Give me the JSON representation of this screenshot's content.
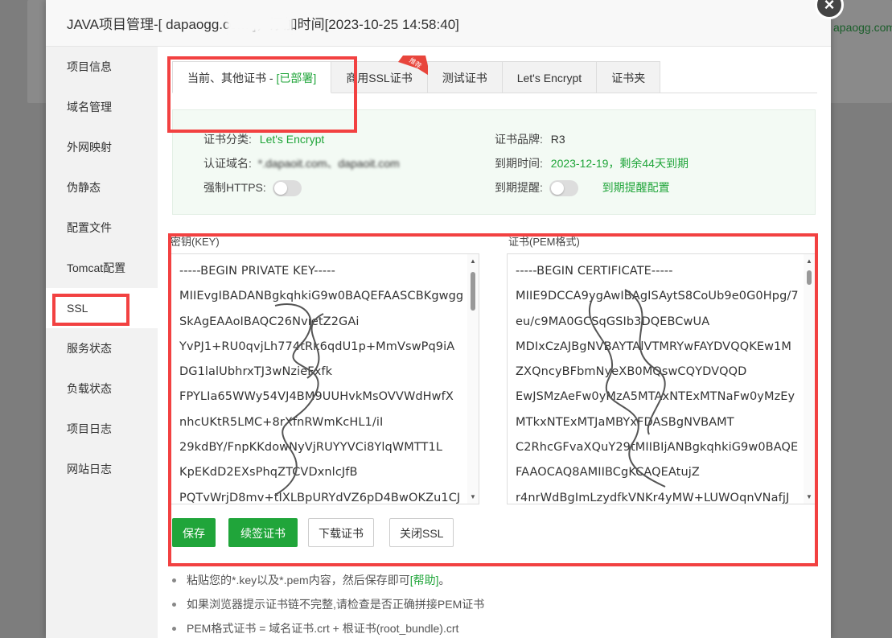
{
  "background": {
    "link_text": "apaogg.com"
  },
  "modal": {
    "title": "JAVA项目管理-[ dapaogg.com ]，添加时间[2023-10-25 14:58:40]",
    "close_glyph": "×"
  },
  "sidebar": {
    "items": [
      {
        "label": "项目信息"
      },
      {
        "label": "域名管理"
      },
      {
        "label": "外网映射"
      },
      {
        "label": "伪静态"
      },
      {
        "label": "配置文件"
      },
      {
        "label": "Tomcat配置"
      },
      {
        "label": "SSL"
      },
      {
        "label": "服务状态"
      },
      {
        "label": "负载状态"
      },
      {
        "label": "项目日志"
      },
      {
        "label": "网站日志"
      }
    ],
    "active_index": 6
  },
  "tabs": [
    {
      "label": "当前、其他证书 - ",
      "status": "[已部署]"
    },
    {
      "label": "商用SSL证书",
      "badge": "推荐"
    },
    {
      "label": "测试证书"
    },
    {
      "label": "Let's Encrypt"
    },
    {
      "label": "证书夹"
    }
  ],
  "cert_info": {
    "category_key": "证书分类:",
    "category_value": "Let's Encrypt",
    "brand_key": "证书品牌:",
    "brand_value": "R3",
    "domain_key": "认证域名:",
    "domain_value": "*.dapaoit.com、dapaoit.com",
    "expire_key": "到期时间:",
    "expire_value": "2023-12-19，剩余44天到期",
    "https_key": "强制HTTPS:",
    "remind_key": "到期提醒:",
    "remind_link": "到期提醒配置"
  },
  "key_area": {
    "label": "密钥(KEY)",
    "lines": [
      "-----BEGIN PRIVATE KEY-----",
      "MIIEvgIBADANBgkqhkiG9w0BAQEFAASCBKgwgg",
      "SkAgEAAoIBAQC26NvietZ2GAi",
      "YvPJ1+RU0qvjLh774tRk6qdU1p+MmVswPq9iA",
      "DG1lalUbhrxTJ3wNzieFxfk",
      "FPYLIa65WWy54VJ4BM9UUHvkMsOVVWdHwfX",
      "nhcUKtR5LMC+8rXfnRWmKcHL1/iI",
      "29kdBY/FnpKKdowNyVjRUYYVCi8YlqWMTT1L",
      "KpEKdD2EXsPhqZTCVDxnlcJfB",
      "PQTvWrjD8mv+tIXLBpURYdVZ6pD4BwOKZu1CJ"
    ]
  },
  "cert_area": {
    "label": "证书(PEM格式)",
    "lines": [
      "-----BEGIN CERTIFICATE-----",
      "MIIE9DCCA9ygAwIBAgISAytS8CoUb9e0G0Hpg/7",
      "eu/c9MA0GCSqGSIb3DQEBCwUA",
      "MDIxCzAJBgNVBAYTAlVTMRYwFAYDVQQKEw1M",
      "ZXQncyBFbmNyeXB0MQswCQYDVQQD",
      "EwJSMzAeFw0yMzA5MTAxNTExMTNaFw0yMzEy",
      "MTkxNTExMTJaMBYxFDASBgNVBAMT",
      "C2RhcGFvaXQuY29tMIIBIjANBgkqhkiG9w0BAQE",
      "FAAOCAQ8AMIIBCgKCAQEAtujZ",
      "r4nrWdBgImLzydfkVNKr4yMW+LUWOqnVNafjJ"
    ]
  },
  "buttons": {
    "save": "保存",
    "renew": "续签证书",
    "download": "下载证书",
    "close_ssl": "关闭SSL"
  },
  "tips": {
    "tip1_prefix": "粘贴您的*.key以及*.pem内容，然后保存即可",
    "tip1_link": "[帮助]",
    "tip1_suffix": "。",
    "tip2": "如果浏览器提示证书链不完整,请检查是否正确拼接PEM证书",
    "tip3": "PEM格式证书 = 域名证书.crt + 根证书(root_bundle).crt"
  },
  "colors": {
    "accent_green": "#20a53a",
    "highlight_red": "#f24141",
    "info_bg": "#f3faf4"
  }
}
